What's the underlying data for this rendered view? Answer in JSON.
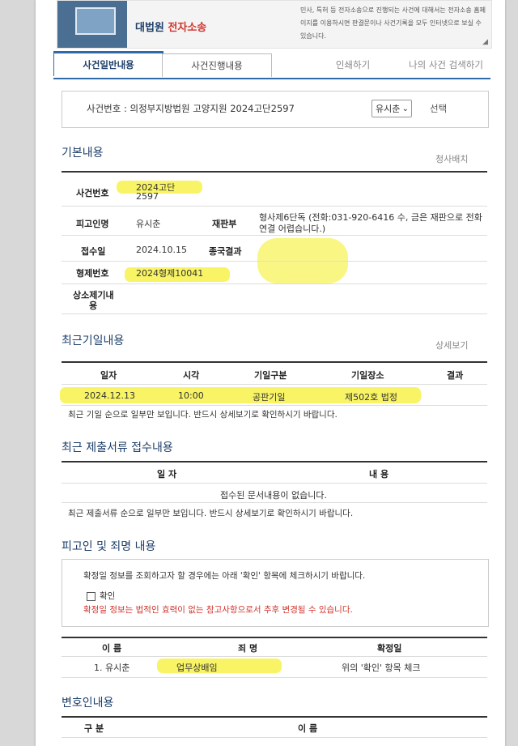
{
  "banner": {
    "title_main": "대법원",
    "title_accent": "전자소송",
    "desc": "민사, 특허 등 전자소송으로 진행되는 사건에 대해서는 전자소송 홈페이지를 이용하시면 판결문이나 사건기록을 모두 인터넷으로 보실 수 있습니다.",
    "corner": "◢"
  },
  "tabs": {
    "active": "사건일반내용",
    "inactive": "사건진행내용",
    "print": "인쇄하기",
    "search": "나의 사건 검색하기"
  },
  "case": {
    "label": "사건번호 : 의정부지방법원 고양지원 2024고단2597",
    "select_value": "유시춘",
    "choose": "선택"
  },
  "basic": {
    "title": "기본내용",
    "link": "청사배치",
    "case_no_label": "사건번호",
    "case_no_line1": "2024고단",
    "case_no_line2": "2597",
    "defendant_label": "피고인명",
    "defendant_value": "유시춘",
    "court_label": "재판부",
    "court_value": "형사제6단독 (전화:031-920-6416 수, 금은 재판으로 전화연결 어렵습니다.)",
    "received_label": "접수일",
    "received_value": "2024.10.15",
    "result_label": "종국결과",
    "result_value": "",
    "criminal_no_label": "형제번호",
    "criminal_no_value": "2024형제10041",
    "appeal_label_line1": "상소제기내",
    "appeal_label_line2": "용"
  },
  "hearing": {
    "title": "최근기일내용",
    "link": "상세보기",
    "headers": [
      "일자",
      "시각",
      "기일구분",
      "기일장소",
      "결과"
    ],
    "rows": [
      [
        "2024.12.13",
        "10:00",
        "공판기일",
        "제502호 법정",
        ""
      ]
    ],
    "note": "최근 기일 순으로 일부만 보입니다. 반드시 상세보기로 확인하시기 바랍니다."
  },
  "documents": {
    "title": "최근 제출서류 접수내용",
    "headers": [
      "일 자",
      "내 용"
    ],
    "empty": "접수된 문서내용이 없습니다.",
    "note": "최근 제출서류 순으로 일부만 보입니다. 반드시 상세보기로 확인하시기 바랍니다."
  },
  "defendant": {
    "title": "피고인 및 죄명 내용",
    "notice": "확정일 정보를 조회하고자 할 경우에는 아래 '확인' 항목에 체크하시기 바랍니다.",
    "checkbox_label": "확인",
    "warning": "확정일 정보는 법적인 효력이 없는 참고사항으로서 추후 변경될 수 있습니다.",
    "headers": [
      "이 름",
      "죄 명",
      "확정일"
    ],
    "rows": [
      [
        "1. 유시춘",
        "업무상배임",
        "위의 '확인' 항목 체크"
      ]
    ]
  },
  "lawyer": {
    "title": "변호인내용",
    "headers": [
      "구 분",
      "이 름"
    ]
  }
}
